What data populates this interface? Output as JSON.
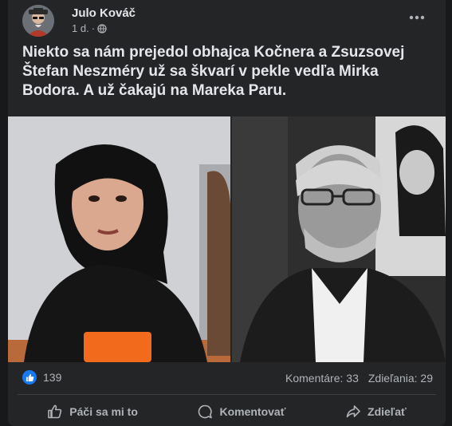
{
  "post": {
    "author": "Julo Kováč",
    "time": "1 d.",
    "privacy_icon": "globe-icon",
    "text": "Niekto sa nám prejedol obhajca Kočnera a Zsuzsovej Štefan Neszméry už sa škvarí v pekle vedľa Mirka Bodora. A už čakajú na Mareka Paru.",
    "more_icon": "more-horizontal-icon"
  },
  "stats": {
    "reaction_icon": "like-reaction-icon",
    "likes": "139",
    "comments": "Komentáre: 33",
    "shares": "Zdieľania: 29"
  },
  "actions": {
    "like": "Páči sa mi to",
    "comment": "Komentovať",
    "share": "Zdieľať"
  },
  "colors": {
    "page_bg": "#18191a",
    "card_bg": "#242526",
    "primary_text": "#e4e6eb",
    "secondary_text": "#b0b3b8",
    "accent": "#1877f2"
  }
}
